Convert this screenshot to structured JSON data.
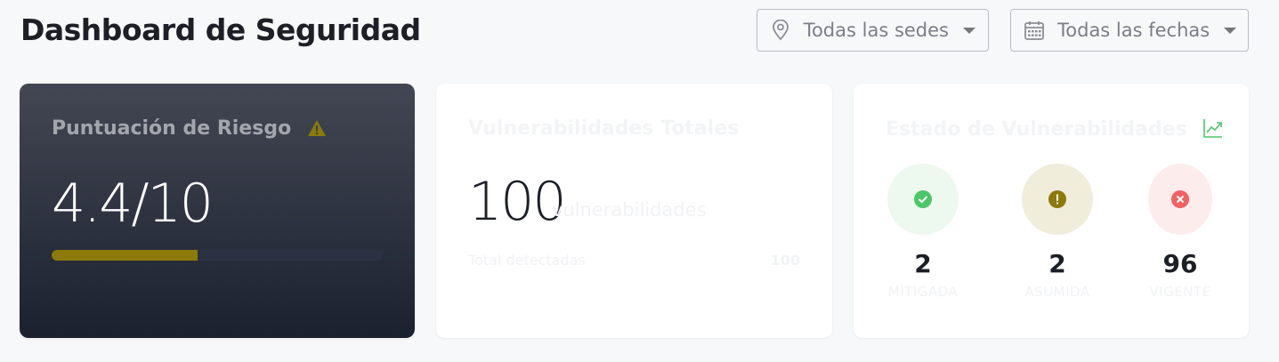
{
  "header": {
    "title": "Dashboard de Seguridad",
    "filters": {
      "location": {
        "icon": "map-pin-icon",
        "label": "Todas las sedes"
      },
      "date": {
        "icon": "calendar-icon",
        "label": "Todas las fechas"
      }
    }
  },
  "risk_card": {
    "title": "Puntuación de Riesgo",
    "icon": "warning-icon",
    "score": "4.4/10",
    "progress_fraction": 0.44,
    "bar_color": "#8c7a0a"
  },
  "vuln_card": {
    "title": "Vulnerabilidades Totales",
    "total": "100",
    "unit": "vulnerabilidades",
    "detected_label": "Total detectadas",
    "detected_value": "100"
  },
  "status_card": {
    "title": "Estado de Vulnerabilidades",
    "icon": "trend-up-icon",
    "items": [
      {
        "icon": "check-circle-icon",
        "count": "2",
        "label": "MITIGADA",
        "color": "#4cc767"
      },
      {
        "icon": "exclamation-circle-icon",
        "count": "2",
        "label": "ASUMIDA",
        "color": "#8c7a0a"
      },
      {
        "icon": "x-circle-icon",
        "count": "96",
        "label": "VIGENTE",
        "color": "#f06262"
      }
    ]
  }
}
